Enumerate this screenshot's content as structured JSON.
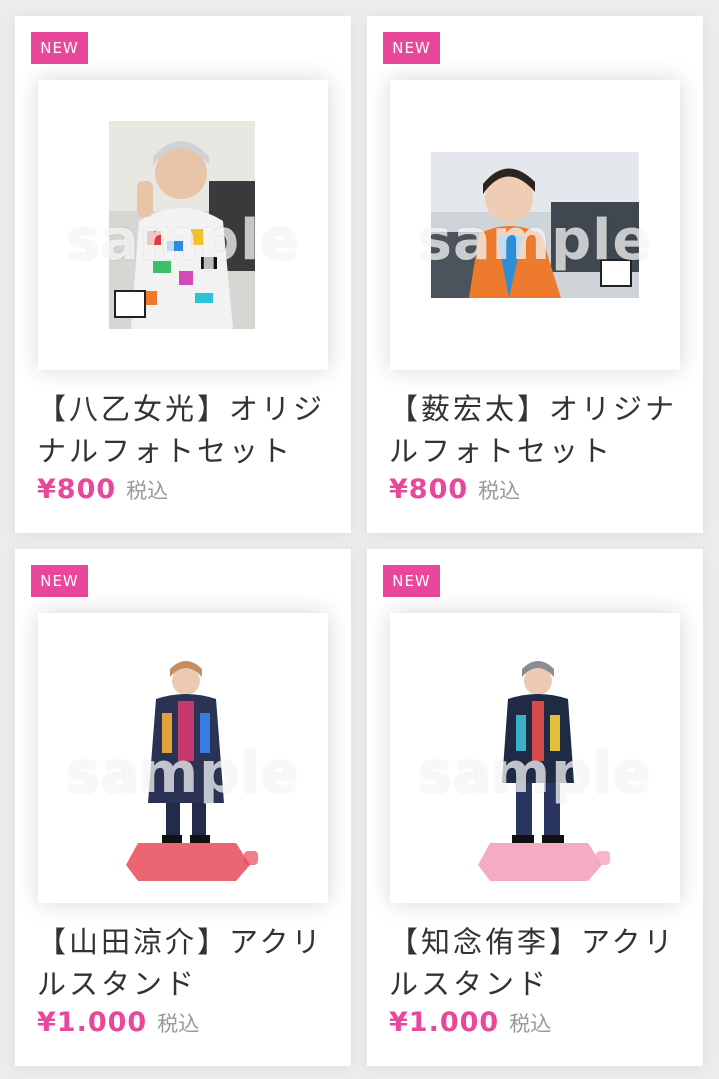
{
  "products": [
    {
      "badge": "NEW",
      "title": "【八乙女光】オリジナルフォトセット",
      "price": "¥800",
      "tax": "税込",
      "watermark": "sample"
    },
    {
      "badge": "NEW",
      "title": "【薮宏太】オリジナルフォトセット",
      "price": "¥800",
      "tax": "税込",
      "watermark": "sample"
    },
    {
      "badge": "NEW",
      "title": "【山田涼介】アクリルスタンド",
      "price": "¥1.000",
      "tax": "税込",
      "watermark": "sample"
    },
    {
      "badge": "NEW",
      "title": "【知念侑李】アクリルスタンド",
      "price": "¥1.000",
      "tax": "税込",
      "watermark": "sample"
    }
  ],
  "colors": {
    "accent": "#e8479b",
    "text": "#333333",
    "muted": "#999999",
    "background": "#ececec"
  }
}
